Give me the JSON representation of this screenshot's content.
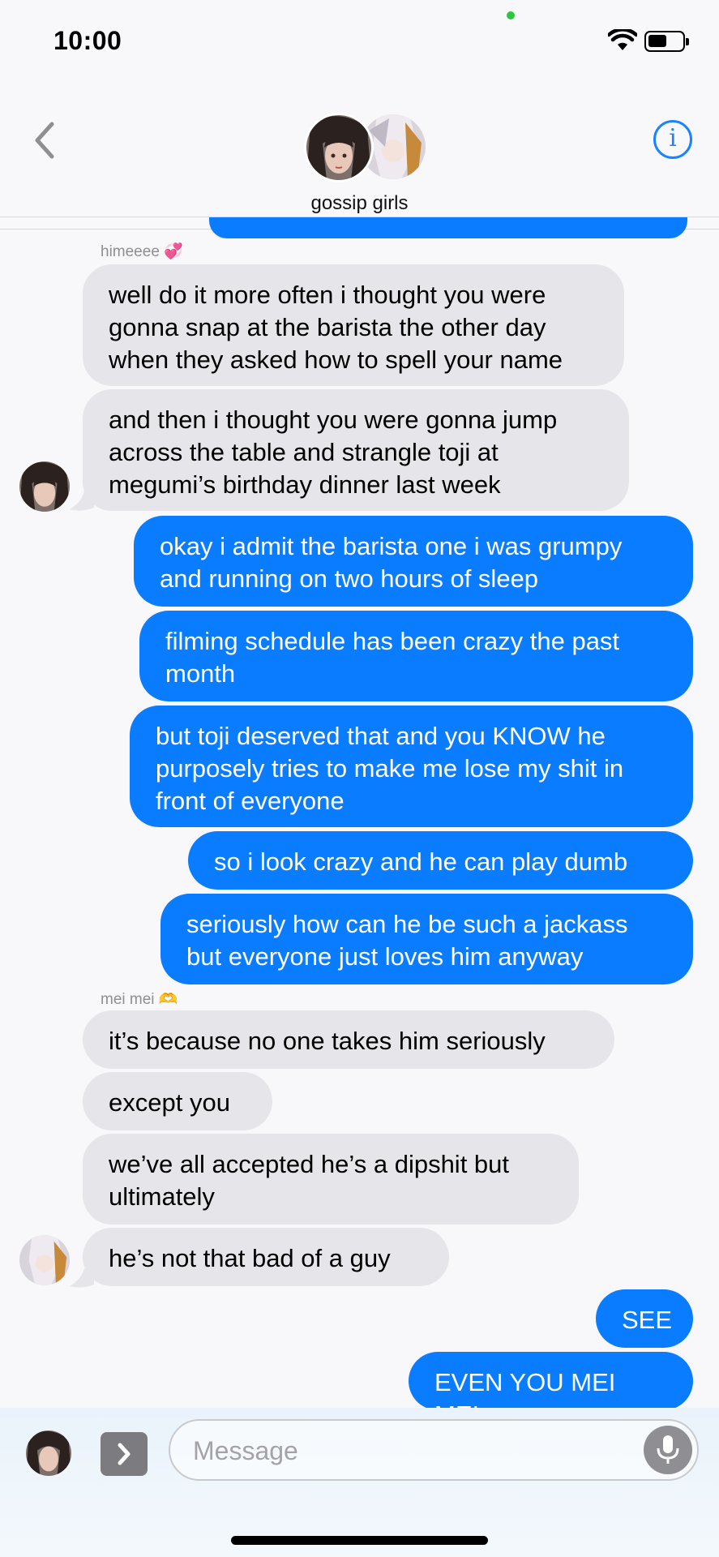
{
  "status_bar": {
    "time": "10:00",
    "battery_level": 0.4
  },
  "header": {
    "group_name": "gossip girls",
    "info_symbol": "i",
    "back_icon": "chevron-left-icon"
  },
  "conversation": {
    "sender_1": {
      "name": "himeeee",
      "emoji": "💞"
    },
    "sender_2": {
      "name": "mei mei",
      "emoji": "🫶"
    },
    "messages": [
      {
        "from": "himeeee",
        "text_lines": [
          "well do it more often i thought you were",
          "gonna snap at the barista the other day",
          "when they asked how to spell your name"
        ]
      },
      {
        "from": "himeeee",
        "text_lines": [
          "and then i thought you were gonna jump",
          "across the table and strangle toji at",
          "megumi’s birthday dinner last week"
        ]
      },
      {
        "from": "me",
        "text_lines": [
          "okay i admit the barista one i was grumpy",
          "and running on two hours of sleep"
        ]
      },
      {
        "from": "me",
        "text_lines": [
          "filming schedule has been crazy the past",
          "month"
        ]
      },
      {
        "from": "me",
        "text_lines": [
          "but toji deserved that and you KNOW he",
          "purposely tries to make me lose my shit in",
          "front of everyone"
        ]
      },
      {
        "from": "me",
        "text_lines": [
          "so i look crazy and he can play dumb"
        ]
      },
      {
        "from": "me",
        "text_lines": [
          "seriously how can he be such a jackass",
          "but everyone just loves him anyway"
        ]
      },
      {
        "from": "mei mei",
        "text_lines": [
          "it’s because no one takes him seriously"
        ]
      },
      {
        "from": "mei mei",
        "text_lines": [
          "except you"
        ]
      },
      {
        "from": "mei mei",
        "text_lines": [
          "we’ve all accepted he’s a dipshit but",
          "ultimately"
        ]
      },
      {
        "from": "mei mei",
        "text_lines": [
          "he’s not that bad of a guy"
        ]
      },
      {
        "from": "me",
        "text_lines": [
          "SEE"
        ]
      },
      {
        "from": "me",
        "text_lines": [
          "EVEN YOU MEI MEI"
        ]
      }
    ]
  },
  "input": {
    "placeholder": "Message",
    "value": ""
  },
  "colors": {
    "accent": "#0a7cff",
    "incoming": "#e6e5ea"
  }
}
